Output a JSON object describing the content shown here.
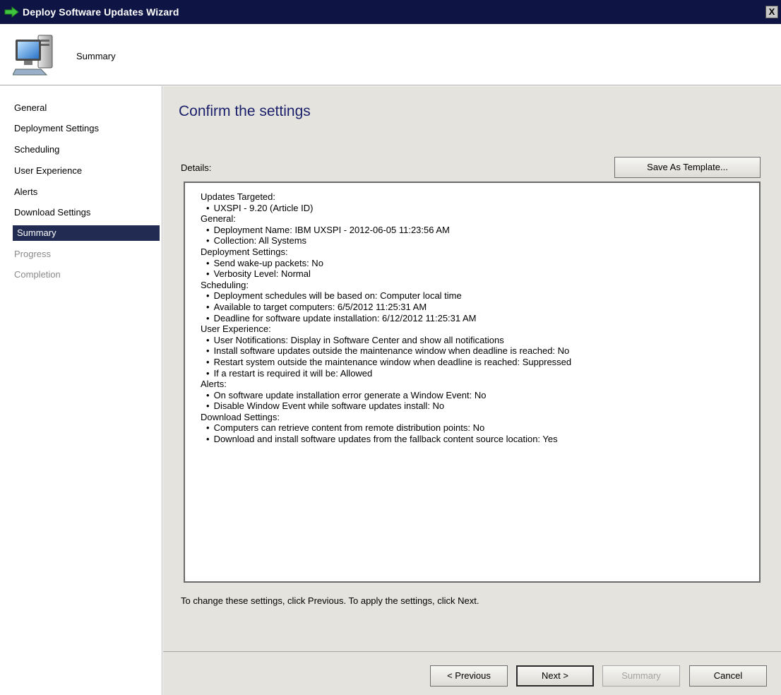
{
  "window": {
    "title": "Deploy Software Updates Wizard",
    "close_label": "X"
  },
  "header": {
    "page_name": "Summary",
    "icon": "computer-icon"
  },
  "sidebar": {
    "items": [
      {
        "label": "General",
        "state": "normal"
      },
      {
        "label": "Deployment Settings",
        "state": "normal"
      },
      {
        "label": "Scheduling",
        "state": "normal"
      },
      {
        "label": "User Experience",
        "state": "normal"
      },
      {
        "label": "Alerts",
        "state": "normal"
      },
      {
        "label": "Download Settings",
        "state": "normal"
      },
      {
        "label": "Summary",
        "state": "active"
      },
      {
        "label": "Progress",
        "state": "disabled"
      },
      {
        "label": "Completion",
        "state": "disabled"
      }
    ]
  },
  "main": {
    "heading": "Confirm the settings",
    "details_label": "Details:",
    "save_template_label": "Save As Template...",
    "instructions": "To change these settings, click Previous. To apply the settings, click Next."
  },
  "details": {
    "sections": [
      {
        "title": "Updates Targeted:",
        "items": [
          "UXSPI - 9.20 (Article ID)"
        ]
      },
      {
        "title": "General:",
        "items": [
          "Deployment Name: IBM UXSPI - 2012-06-05 11:23:56 AM",
          "Collection: All Systems"
        ]
      },
      {
        "title": "Deployment Settings:",
        "items": [
          "Send wake-up packets: No",
          "Verbosity Level: Normal"
        ]
      },
      {
        "title": "Scheduling:",
        "items": [
          "Deployment schedules will be based on: Computer local time",
          "Available to target computers: 6/5/2012 11:25:31 AM",
          "Deadline for software update installation: 6/12/2012 11:25:31 AM"
        ]
      },
      {
        "title": "User Experience:",
        "items": [
          "User Notifications: Display in Software Center and show all notifications",
          "Install software updates outside the maintenance window when deadline is reached: No",
          "Restart system outside the maintenance window when deadline is reached: Suppressed",
          "If a restart is required it will be: Allowed"
        ]
      },
      {
        "title": "Alerts:",
        "items": [
          "On software update installation error generate a Window Event: No",
          "Disable Window Event while software updates install: No"
        ]
      },
      {
        "title": "Download Settings:",
        "items": [
          "Computers can retrieve content from remote distribution points: No",
          "Download and install software updates from the fallback content source location: Yes"
        ]
      }
    ]
  },
  "footer": {
    "previous_label": "< Previous",
    "next_label": "Next >",
    "summary_label": "Summary",
    "cancel_label": "Cancel"
  }
}
